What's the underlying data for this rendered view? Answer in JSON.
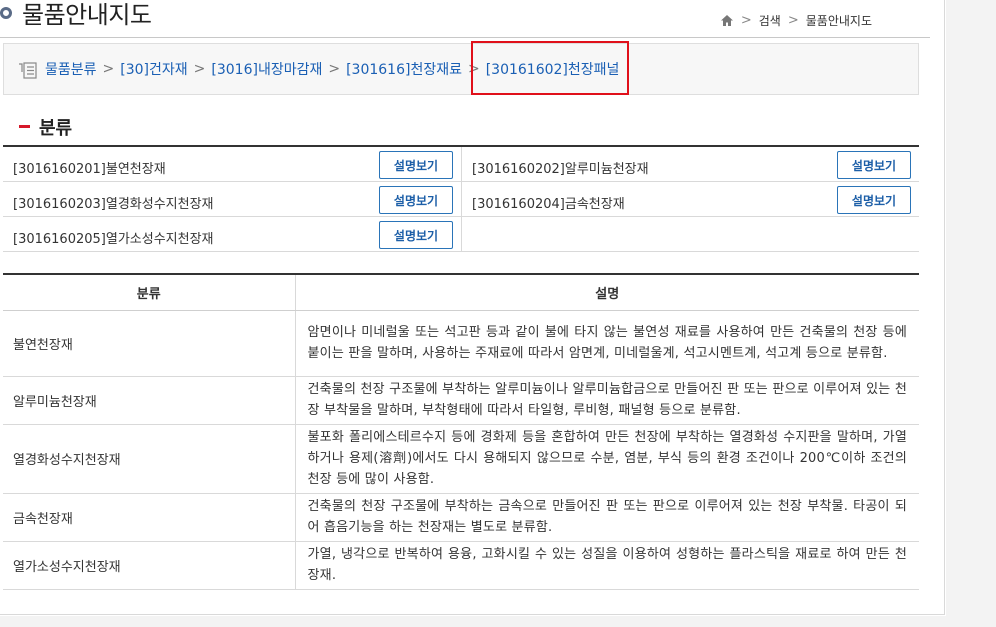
{
  "header": {
    "title": "물품안내지도",
    "breadcrumb": {
      "home_icon": "home-icon",
      "items": [
        "검색",
        "물품안내지도"
      ]
    }
  },
  "path": {
    "icon": "list-tree-icon",
    "items": [
      "물품분류",
      "[30]건자재",
      "[3016]내장마감재",
      "[301616]천장재료",
      "[30161602]천장패널"
    ]
  },
  "section": {
    "title": "분류"
  },
  "categories": [
    {
      "label": "[3016160201]불연천장재",
      "button": "설명보기"
    },
    {
      "label": "[3016160202]알루미늄천장재",
      "button": "설명보기"
    },
    {
      "label": "[3016160203]열경화성수지천장재",
      "button": "설명보기"
    },
    {
      "label": "[3016160204]금속천장재",
      "button": "설명보기"
    },
    {
      "label": "[3016160205]열가소성수지천장재",
      "button": "설명보기"
    }
  ],
  "table": {
    "headers": [
      "분류",
      "설명"
    ],
    "rows": [
      {
        "name": "불연천장재",
        "desc": "암면이나 미네럴울 또는 석고판 등과 같이 불에 타지 않는 불연성 재료를 사용하여 만든 건축물의 천장 등에 붙이는 판을 말하며, 사용하는 주재료에 따라서 암면계, 미네럴울계, 석고시멘트계, 석고계 등으로 분류함."
      },
      {
        "name": "알루미늄천장재",
        "desc": "건축물의 천장 구조물에 부착하는 알루미늄이나 알루미늄합금으로 만들어진 판 또는 판으로 이루어져 있는 천장 부착물을 말하며, 부착형태에 따라서 타일형, 루비형, 패널형 등으로 분류함."
      },
      {
        "name": "열경화성수지천장재",
        "desc": "불포화 폴리에스테르수지 등에 경화제 등을 혼합하여 만든 천장에 부착하는 열경화성 수지판을 말하며, 가열하거나 용제(溶劑)에서도 다시 용해되지 않으므로 수분, 염분, 부식 등의 환경 조건이나 200℃이하 조건의 천장 등에 많이 사용함."
      },
      {
        "name": "금속천장재",
        "desc": "건축물의 천장 구조물에 부착하는 금속으로 만들어진 판 또는 판으로 이루어져 있는 천장 부착물. 타공이 되어 흡음기능을 하는 천장재는 별도로 분류함."
      },
      {
        "name": "열가소성수지천장재",
        "desc": "가열, 냉각으로 반복하여 용융, 고화시킬 수 있는 성질을 이용하여 성형하는 플라스틱을 재료로 하여 만든 천장재."
      }
    ]
  },
  "colors": {
    "accent": "#d6182a",
    "link": "#1a5fb4",
    "highlight": "#e0101a",
    "button_border": "#2a74b8"
  }
}
